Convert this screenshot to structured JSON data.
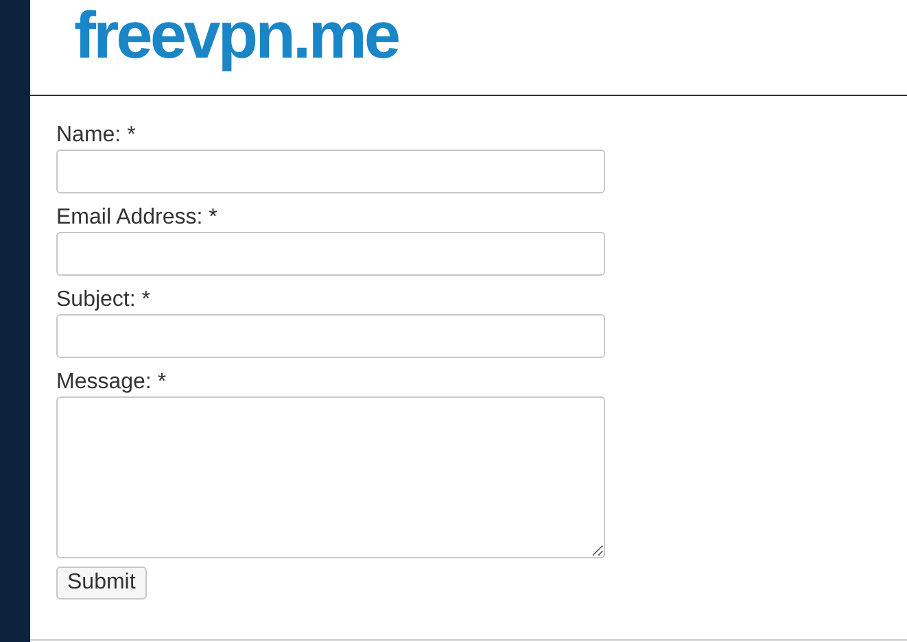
{
  "logo": {
    "text": "freevpn.me"
  },
  "form": {
    "fields": [
      {
        "label": "Name: *",
        "kind": "input"
      },
      {
        "label": "Email Address: *",
        "kind": "input"
      },
      {
        "label": "Subject: *",
        "kind": "input"
      },
      {
        "label": "Message: *",
        "kind": "textarea"
      }
    ],
    "submit": "Submit"
  }
}
